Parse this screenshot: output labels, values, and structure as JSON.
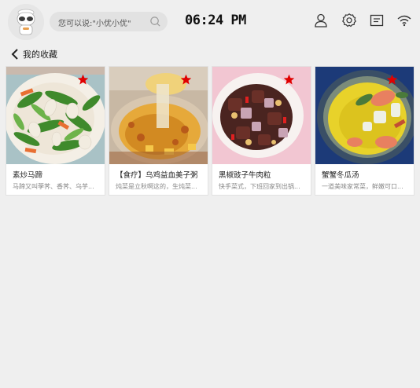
{
  "header": {
    "search_placeholder": "您可以说:\"小优小优\"",
    "time": "06:24 PM",
    "icons": [
      "robot-avatar",
      "search-icon",
      "user-icon",
      "settings-icon",
      "message-icon",
      "wifi-icon"
    ]
  },
  "page": {
    "title": "我的收藏",
    "back_icon": "chevron-left-icon"
  },
  "favorites": [
    {
      "title": "素炒马蹄",
      "desc": "马蹄又叫荸荠、香荠、乌芋...",
      "starred": true
    },
    {
      "title": "【食疗】乌鸡益血美子粥",
      "desc": "炖菜是立秋啊这的，生炖菜...",
      "starred": true
    },
    {
      "title": "黑椒豉子牛肉粒",
      "desc": "快手菜式，下班回家到出锅...",
      "starred": true
    },
    {
      "title": "蟹蟹冬瓜汤",
      "desc": "一道美味家常菜，鲜嫩可口...",
      "starred": true
    }
  ],
  "colors": {
    "star": "#e00000",
    "background": "#efefef",
    "card": "#ffffff"
  }
}
